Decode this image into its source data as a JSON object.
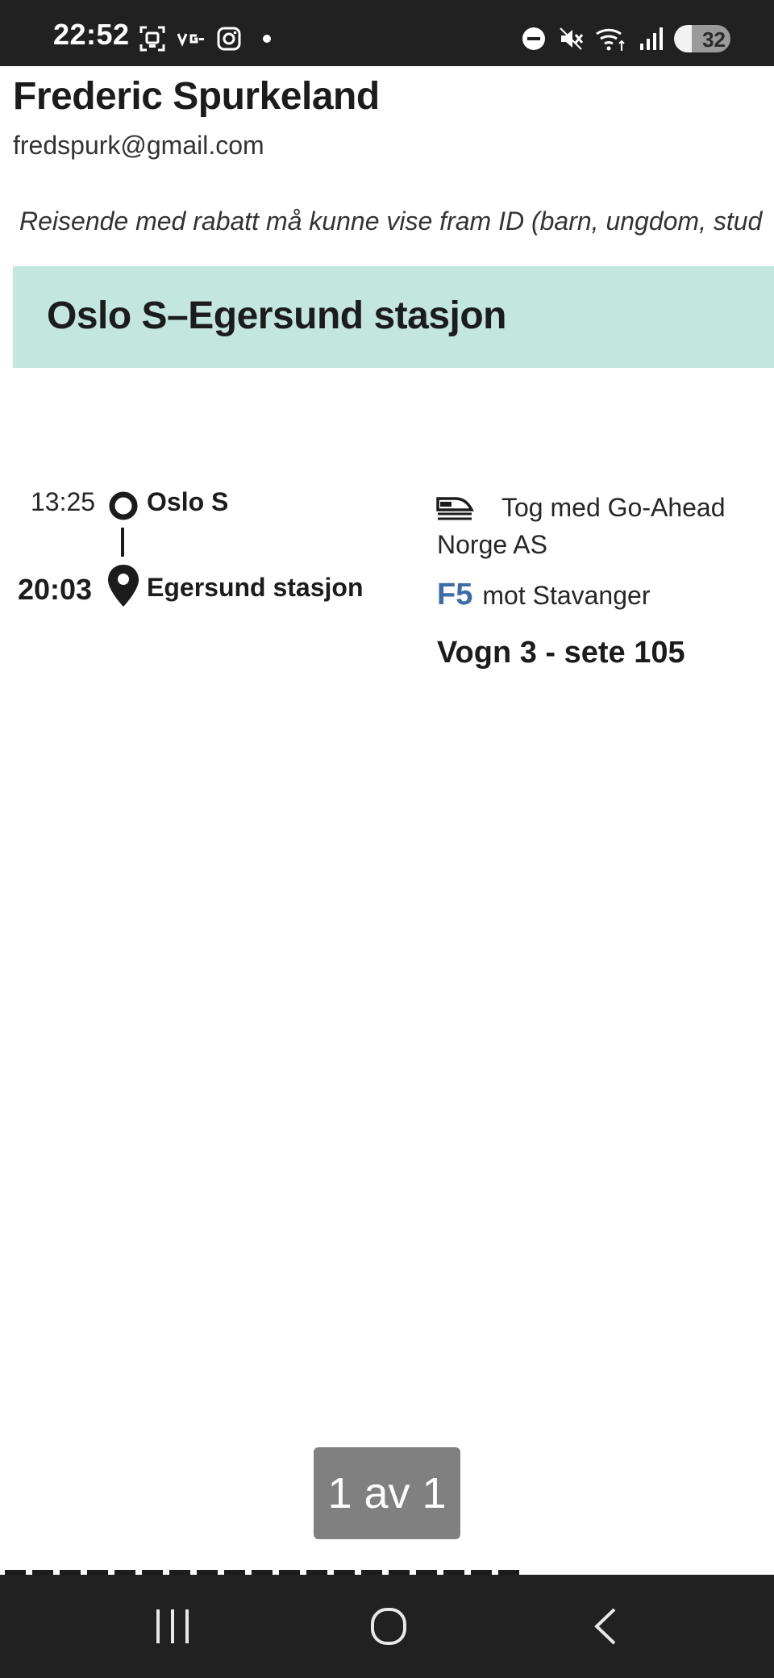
{
  "status_bar": {
    "time": "22:52",
    "battery_level": 32,
    "battery_text": "32",
    "left_icons": [
      "screenshot-icon",
      "vg-icon",
      "instagram-icon",
      "notification-dot-icon"
    ],
    "right_icons": [
      "do-not-disturb-icon",
      "mute-icon",
      "wifi-icon",
      "signal-icon",
      "battery-icon"
    ]
  },
  "user": {
    "name": "Frederic Spurkeland",
    "email": "fredspurk@gmail.com"
  },
  "notice": "Reisende med rabatt må kunne vise fram ID (barn, ungdom, stud",
  "route": {
    "title": "Oslo S–Egersund stasjon",
    "banner_color": "#c3e6df"
  },
  "trip": {
    "departure_time": "13:25",
    "origin": "Oslo S",
    "arrival_time": "20:03",
    "destination": "Egersund stasjon",
    "operator": "Tog med Go-Ahead Norge AS",
    "line_code": "F5",
    "line_code_color": "#3d6ca8",
    "direction": "mot Stavanger",
    "seat": "Vogn 3 - sete 105"
  },
  "pager": {
    "label": "1 av 1"
  },
  "nav_bar": {
    "buttons": [
      "recents-icon",
      "home-icon",
      "back-icon"
    ]
  }
}
